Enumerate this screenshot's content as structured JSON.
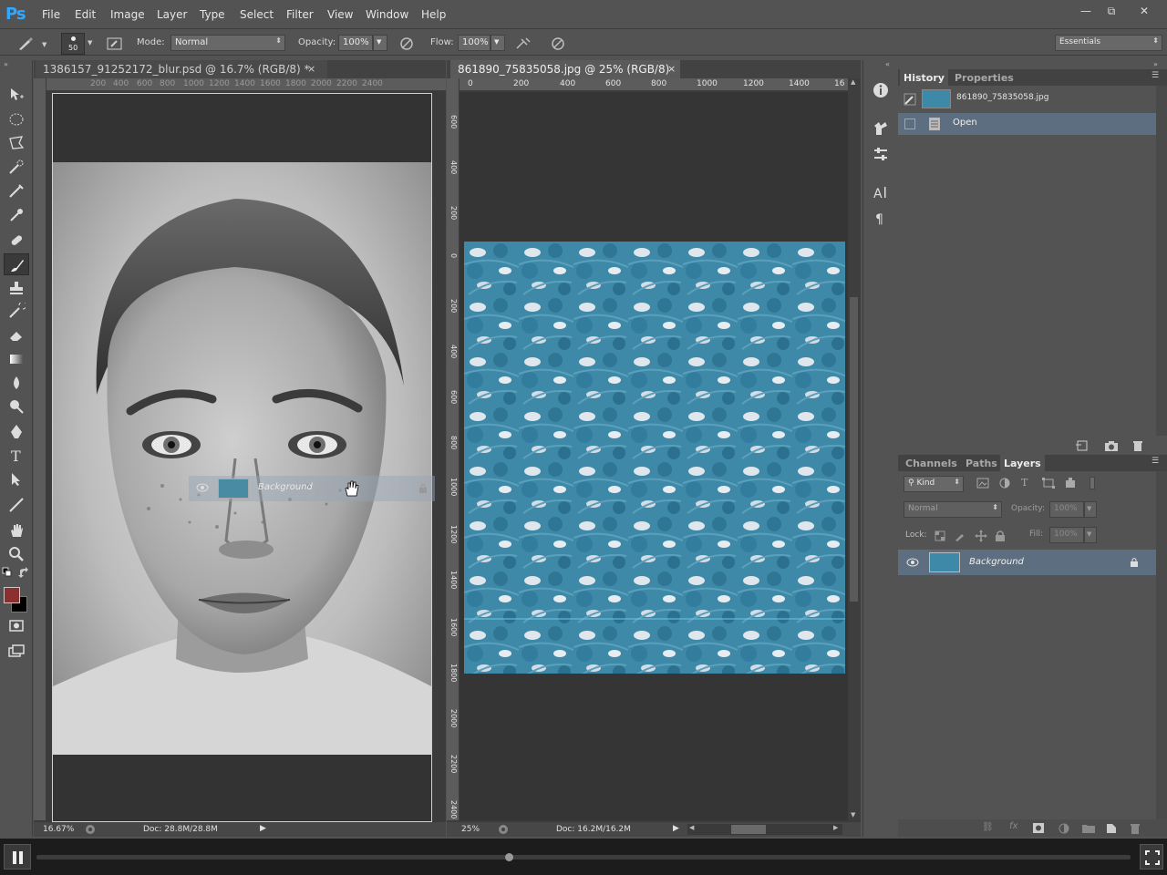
{
  "app": {
    "logo": "Ps"
  },
  "menu": [
    "File",
    "Edit",
    "Image",
    "Layer",
    "Type",
    "Select",
    "Filter",
    "View",
    "Window",
    "Help"
  ],
  "window_controls": {
    "minimize": "—",
    "restore": "⧉",
    "close": "✕"
  },
  "options_bar": {
    "brush_size": "50",
    "mode_label": "Mode:",
    "mode_value": "Normal",
    "opacity_label": "Opacity:",
    "opacity_value": "100%",
    "flow_label": "Flow:",
    "flow_value": "100%",
    "workspace": "Essentials"
  },
  "colors": {
    "foreground": "#8b2f2f",
    "background": "#000000",
    "accent": "#31a8ff",
    "selected_row": "#5d6e80"
  },
  "doc_left": {
    "tab_title": "1386157_91252172_blur.psd @ 16.7% (RGB/8) *",
    "ruler_ticks": [
      "200",
      "400",
      "600",
      "800",
      "1000",
      "1200",
      "1400",
      "1600",
      "1800",
      "2000",
      "2200",
      "2400"
    ],
    "zoom": "16.67%",
    "doc_size": "Doc: 28.8M/28.8M",
    "drag_layer_label": "Background"
  },
  "doc_right": {
    "tab_title": "861890_75835058.jpg @ 25% (RGB/8)",
    "ruler_ticks_h": [
      "0",
      "200",
      "400",
      "600",
      "800",
      "1000",
      "1200",
      "1400",
      "16"
    ],
    "ruler_ticks_v": [
      "600",
      "400",
      "200",
      "0",
      "200",
      "400",
      "600",
      "800",
      "1000",
      "1200",
      "1400",
      "1600",
      "1800",
      "2000",
      "2200",
      "2400"
    ],
    "zoom": "25%",
    "doc_size": "Doc: 16.2M/16.2M"
  },
  "history_panel": {
    "tabs": [
      "History",
      "Properties"
    ],
    "snapshot_label": "861890_75835058.jpg",
    "items": [
      "Open"
    ]
  },
  "layers_panel": {
    "tabs": [
      "Channels",
      "Paths",
      "Layers"
    ],
    "filter_kind": "Kind",
    "blend_mode": "Normal",
    "opacity_label": "Opacity:",
    "opacity_value": "100%",
    "lock_label": "Lock:",
    "fill_label": "Fill:",
    "fill_value": "100%",
    "layers": [
      "Background"
    ]
  }
}
